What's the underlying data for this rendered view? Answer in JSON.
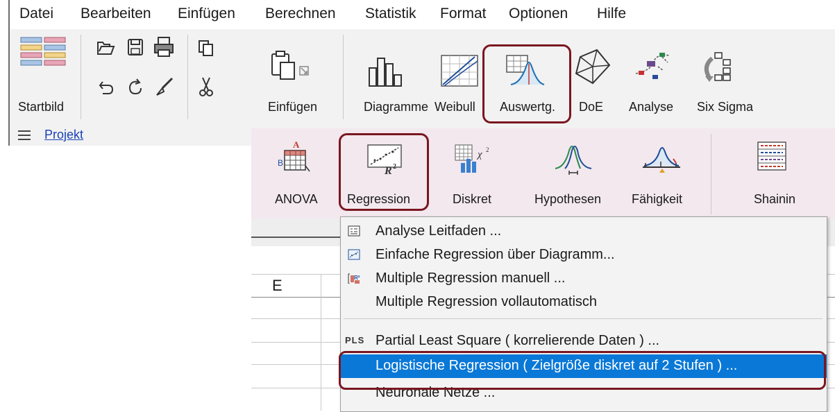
{
  "menu": {
    "items": [
      "Datei",
      "Bearbeiten",
      "Einfügen",
      "Berechnen",
      "Statistik",
      "Format",
      "Optionen",
      "Hilfe"
    ]
  },
  "toolbar": {
    "startbild": "Startbild",
    "einfuegen": "Einfügen",
    "diagramme": "Diagramme",
    "weibull": "Weibull",
    "auswertg": "Auswertg.",
    "doe": "DoE",
    "analyse": "Analyse",
    "six_sigma": "Six Sigma",
    "projekt": "Projekt"
  },
  "subribbon": {
    "anova": "ANOVA",
    "regression": "Regression",
    "diskret": "Diskret",
    "hypothesen": "Hypothesen",
    "faehigkeit": "Fähigkeit",
    "shainin": "Shainin"
  },
  "grid": {
    "column_e": "E"
  },
  "dropdown": {
    "items": [
      {
        "label": "Analyse Leitfaden ...",
        "icon": "guide-icon"
      },
      {
        "label": "Einfache Regression über Diagramm...",
        "icon": "scatter-icon"
      },
      {
        "label": "Multiple Regression manuell ...",
        "icon": "r2-icon"
      },
      {
        "label": "Multiple Regression vollautomatisch",
        "icon": ""
      },
      {
        "label": "Partial Least Square  ( korrelierende Daten ) ...",
        "icon": "PLS"
      },
      {
        "label": "Logistische Regression  ( Zielgröße diskret auf 2 Stufen ) ...",
        "icon": ""
      },
      {
        "label": "Neuronale Netze ...",
        "icon": ""
      }
    ]
  },
  "colors": {
    "highlight": "#0a78d7",
    "annotation_box": "#7a1620",
    "subribbon_bg": "#f2e8ee"
  }
}
